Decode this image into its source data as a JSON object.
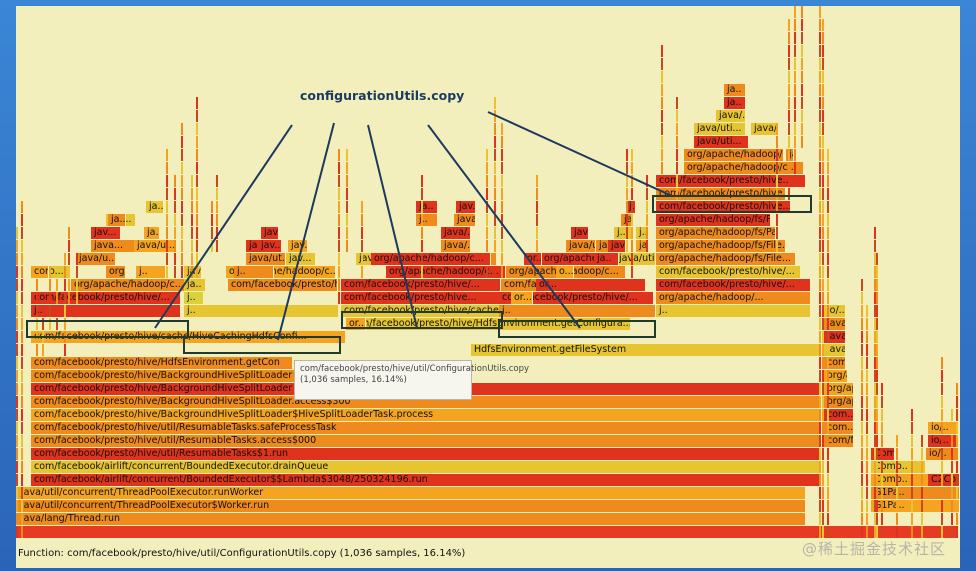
{
  "annotation": "configurationUtils.copy",
  "status_text": "Function: com/facebook/presto/hive/util/ConfigurationUtils.copy (1,036 samples, 16.14%)",
  "tooltip": "com/facebook/presto/hive/util/ConfigurationUtils.copy (1,036 samples, 16.14%)",
  "watermark": "@稀土掘金技术社区",
  "colors": {
    "red": "#e0331e",
    "orange": "#ef8a1c",
    "yellow": "#e6c530",
    "amber": "#f4a41e",
    "gold": "#d9d23a",
    "pale": "#f2efbd"
  },
  "frames": [
    {
      "label": "java/lang/Thread.run"
    },
    {
      "label": "java/util/concurrent/ThreadPoolExecutor$Worker.run"
    },
    {
      "label": "java/util/concurrent/ThreadPoolExecutor.runWorker"
    },
    {
      "label": "com/facebook/airlift/concurrent/BoundedExecutor$$Lambda$3048/250324196.run"
    },
    {
      "label": "com/facebook/airlift/concurrent/BoundedExecutor.drainQueue"
    },
    {
      "label": "com/facebook/presto/hive/util/ResumableTasks$1.run"
    },
    {
      "label": "com/facebook/presto/hive/util/ResumableTasks.access$000"
    },
    {
      "label": "com/facebook/presto/hive/util/ResumableTasks.safeProcessTask"
    },
    {
      "label": "com/facebook/presto/hive/BackgroundHiveSplitLoader$HiveSplitLoaderTask.process"
    },
    {
      "label": "com/facebook/presto/hive/BackgroundHiveSplitLoader.access$300"
    },
    {
      "label": "com/facebook/presto/hive/BackgroundHiveSplitLoader"
    },
    {
      "label": "com/facebook/presto/hive/BackgroundHiveSplitLoader"
    },
    {
      "label": "com/facebook/presto/hive/HdfsEnvironment.getCon"
    },
    {
      "label": "HdfsEnvironment.getFileSystem"
    },
    {
      "label": "com/facebook/presto/hive/cache/HiveCachingHdfsConfi..."
    },
    {
      "label": "com/facebook/presto/hive/HdfsEnvironment.getConfigura..."
    },
    {
      "label": "com/facebook/presto/hive/cache/HiveCachingHdfsConfigu..."
    },
    {
      "label": "com/facebook/presto/hive/..."
    },
    {
      "label": "com/facebook/presto/hive/..."
    },
    {
      "label": "com/facebook/presto/hive..."
    },
    {
      "label": "com/facebook/presto/hive/..."
    },
    {
      "label": "com/facebook/presto/hive/..."
    },
    {
      "label": "com/facebook/presto/hive/..."
    },
    {
      "label": "com/facebook/presto/hive/..."
    },
    {
      "label": "org/apache/hadoop/c..."
    },
    {
      "label": "org/apache/hadoop/c..."
    },
    {
      "label": "org/apache/hadoop/c..."
    },
    {
      "label": "org/apache/hadoop/c..."
    },
    {
      "label": "org/apache/hadoop/..."
    },
    {
      "label": "org/apache/hadoop/..."
    },
    {
      "label": "com/facebook/presto/hive/..."
    },
    {
      "label": "org/apache/hadoop/fs/File..."
    },
    {
      "label": "org/apache/hadoop/fs/File..."
    },
    {
      "label": "org/apache/hadoop/fs/Path..."
    },
    {
      "label": "org/apache/hadoop/fs/Pre..."
    },
    {
      "label": "com/facebook/presto/hive..."
    },
    {
      "label": "com/facebook/presto/hive..."
    },
    {
      "label": "com/facebook/presto/hive.."
    },
    {
      "label": "org/apache/hadoop/c..."
    },
    {
      "label": "org/apache/hadoop/..."
    },
    {
      "label": "java/uti..."
    },
    {
      "label": "java/uti..."
    },
    {
      "label": "java/uti..."
    },
    {
      "label": "java/.."
    },
    {
      "label": "ja.."
    },
    {
      "label": "ja.."
    },
    {
      "label": "java/ut.."
    },
    {
      "label": "org/apache/hadoop/..."
    },
    {
      "label": "org/apache/hadoop/c..."
    },
    {
      "label": "org/apache/hadoop/c..."
    },
    {
      "label": "org/apache/hadoop/..."
    },
    {
      "label": "java/uti.."
    },
    {
      "label": "java/uti.."
    },
    {
      "label": "java/ut.."
    },
    {
      "label": "java/..."
    },
    {
      "label": "java..."
    },
    {
      "label": "jav..."
    },
    {
      "label": "jav..."
    },
    {
      "label": "java/..."
    },
    {
      "label": "java/..."
    },
    {
      "label": "java/u..."
    },
    {
      "label": "java/u..."
    },
    {
      "label": "ja.."
    },
    {
      "label": "ja.."
    },
    {
      "label": "ja.."
    },
    {
      "label": "j.."
    },
    {
      "label": "ja.."
    },
    {
      "label": "jav..."
    },
    {
      "label": "java/..."
    },
    {
      "label": "java/ut..."
    },
    {
      "label": "java/ut..."
    },
    {
      "label": "java/u..."
    },
    {
      "label": "ja.."
    },
    {
      "label": "java/..."
    },
    {
      "label": "j.."
    },
    {
      "label": "j.."
    },
    {
      "label": "j.."
    },
    {
      "label": "jav..."
    },
    {
      "label": "jav..."
    },
    {
      "label": "jav.."
    },
    {
      "label": "jav..."
    },
    {
      "label": "java/u..."
    },
    {
      "label": "ja.."
    },
    {
      "label": "j.."
    },
    {
      "label": "j.."
    },
    {
      "label": "or..."
    },
    {
      "label": "or..."
    },
    {
      "label": "or..."
    },
    {
      "label": "o..."
    },
    {
      "label": "o..."
    },
    {
      "label": "or..."
    },
    {
      "label": "or.."
    },
    {
      "label": "ja..."
    },
    {
      "label": "j.."
    },
    {
      "label": "ja..."
    },
    {
      "label": "j.."
    },
    {
      "label": "j.."
    },
    {
      "label": "j.."
    },
    {
      "label": "j.."
    },
    {
      "label": "j.."
    },
    {
      "label": "com/facebook/presto/hive/..."
    },
    {
      "label": "com/facebook/presto/hive..."
    },
    {
      "label": "com/facebook/presto/hive/..."
    },
    {
      "label": "com/facebook/presto/hive..."
    },
    {
      "label": "or..."
    },
    {
      "label": "org/apache/hadoop/c..."
    },
    {
      "label": "org/apache/hadoop/c..."
    },
    {
      "label": "org/apache/hadoop/..."
    },
    {
      "label": "org/apache/hadoop/c..."
    },
    {
      "label": "org/apache/hadoop/..."
    },
    {
      "label": "org/apache/hadoop/c..."
    },
    {
      "label": "com/facebook/presto/hive/..."
    },
    {
      "label": "com.."
    },
    {
      "label": "com.."
    },
    {
      "label": "com.."
    },
    {
      "label": "java.."
    },
    {
      "label": "java.."
    },
    {
      "label": "java/..."
    },
    {
      "label": "io/.."
    },
    {
      "label": "io/.."
    },
    {
      "label": "io/.."
    },
    {
      "label": "io/.."
    },
    {
      "label": "io/.."
    },
    {
      "label": "C.."
    },
    {
      "label": "Comp.."
    },
    {
      "label": "Comp.."
    },
    {
      "label": "Comp.."
    },
    {
      "label": "C2Co.."
    },
    {
      "label": "G1Pa.."
    },
    {
      "label": "G1Pa.."
    },
    {
      "label": "G1ParTa.."
    },
    {
      "label": "GangWork.."
    },
    {
      "label": "JavaT.."
    },
    {
      "label": "java_start(Thre.."
    },
    {
      "label": "start_thread"
    }
  ]
}
